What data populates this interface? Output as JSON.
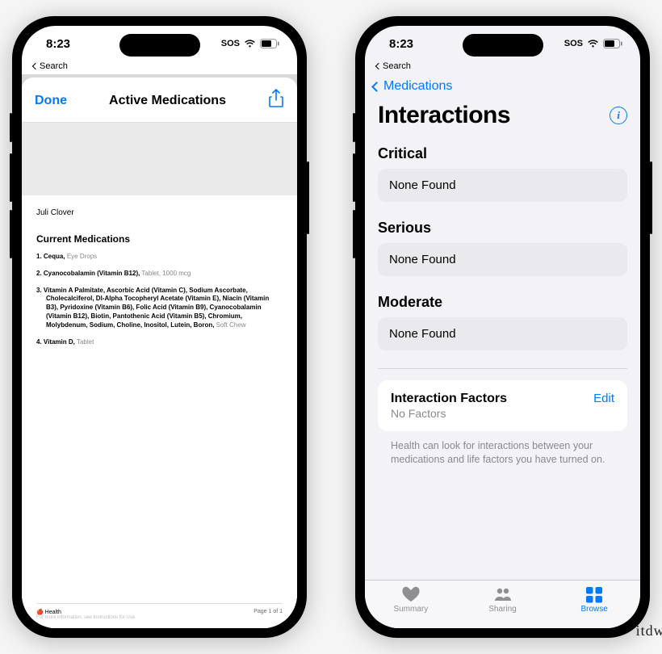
{
  "status": {
    "time": "8:23",
    "sos": "SOS",
    "search_back": "Search"
  },
  "phone1": {
    "done": "Done",
    "title": "Active Medications",
    "user": "Juli Clover",
    "section_heading": "Current Medications",
    "meds": [
      {
        "n": "1.",
        "name": "Cequa,",
        "detail": "Eye Drops"
      },
      {
        "n": "2.",
        "name": "Cyanocobalamin (Vitamin B12),",
        "detail": "Tablet, 1000 mcg"
      },
      {
        "n": "3.",
        "name": "Vitamin A Palmitate, Ascorbic Acid (Vitamin C), Sodium Ascorbate, Cholecalciferol, Dl-Alpha Tocopheryl Acetate (Vitamin E), Niacin (Vitamin B3), Pyridoxine (Vitamin B6), Folic Acid (Vitamin B9), Cyanocobalamin (Vitamin B12), Biotin, Pantothenic Acid (Vitamin B5), Chromium, Molybdenum, Sodium, Choline, Inositol, Lutein, Boron,",
        "detail": "Soft Chew"
      },
      {
        "n": "4.",
        "name": "Vitamin D,",
        "detail": "Tablet"
      }
    ],
    "footer_brand": "Health",
    "footer_page": "Page 1 of 1",
    "footer_note": "For more information, see Instructions for Use."
  },
  "phone2": {
    "back_label": "Medications",
    "page_title": "Interactions",
    "severities": [
      {
        "label": "Critical",
        "result": "None Found"
      },
      {
        "label": "Serious",
        "result": "None Found"
      },
      {
        "label": "Moderate",
        "result": "None Found"
      }
    ],
    "factors": {
      "title": "Interaction Factors",
      "subtitle": "No Factors",
      "edit": "Edit",
      "note": "Health can look for interactions between your medications and life factors you have turned on."
    },
    "tabs": {
      "summary": "Summary",
      "sharing": "Sharing",
      "browse": "Browse"
    }
  },
  "watermark": "itdw.cn"
}
